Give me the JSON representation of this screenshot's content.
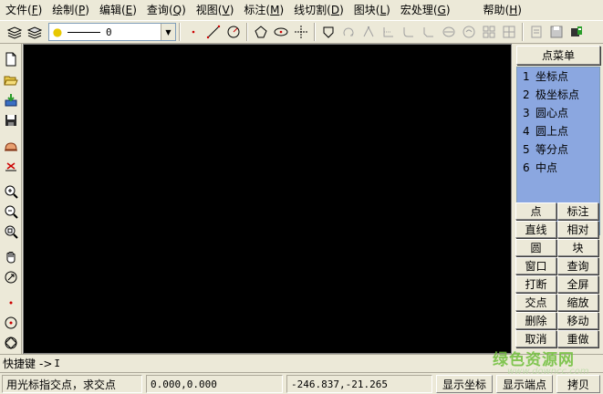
{
  "menu": [
    {
      "label": "文件",
      "key": "F"
    },
    {
      "label": "绘制",
      "key": "P"
    },
    {
      "label": "编辑",
      "key": "E"
    },
    {
      "label": "查询",
      "key": "Q"
    },
    {
      "label": "视图",
      "key": "V"
    },
    {
      "label": "标注",
      "key": "M"
    },
    {
      "label": "线切割",
      "key": "D"
    },
    {
      "label": "图块",
      "key": "L"
    },
    {
      "label": "宏处理",
      "key": "G"
    },
    {
      "label": "帮助",
      "key": "H"
    }
  ],
  "toolbar": {
    "layer_value": "0"
  },
  "right_panel": {
    "title": "点菜单",
    "items": [
      {
        "num": "1",
        "label": "坐标点"
      },
      {
        "num": "2",
        "label": "极坐标点"
      },
      {
        "num": "3",
        "label": "圆心点"
      },
      {
        "num": "4",
        "label": "圆上点"
      },
      {
        "num": "5",
        "label": "等分点"
      },
      {
        "num": "6",
        "label": "中点"
      }
    ],
    "buttons": [
      [
        "点",
        "标注"
      ],
      [
        "直线",
        "相对"
      ],
      [
        "圆",
        "块"
      ],
      [
        "窗口",
        "查询"
      ],
      [
        "打断",
        "全屏"
      ],
      [
        "交点",
        "缩放"
      ],
      [
        "删除",
        "移动"
      ],
      [
        "取消",
        "重做"
      ]
    ]
  },
  "command": {
    "label": "快捷键",
    "arrow": "->",
    "value": "I"
  },
  "status": {
    "prompt": "用光标指交点，求交点",
    "coord1": "0.000,0.000",
    "coord2": "-246.837,-21.265",
    "btn_show_coord": "显示坐标",
    "btn_show_end": "显示端点",
    "btn_copy": "拷贝"
  },
  "watermark": {
    "text": "绿色资源网",
    "url": "www.downcc.com"
  }
}
